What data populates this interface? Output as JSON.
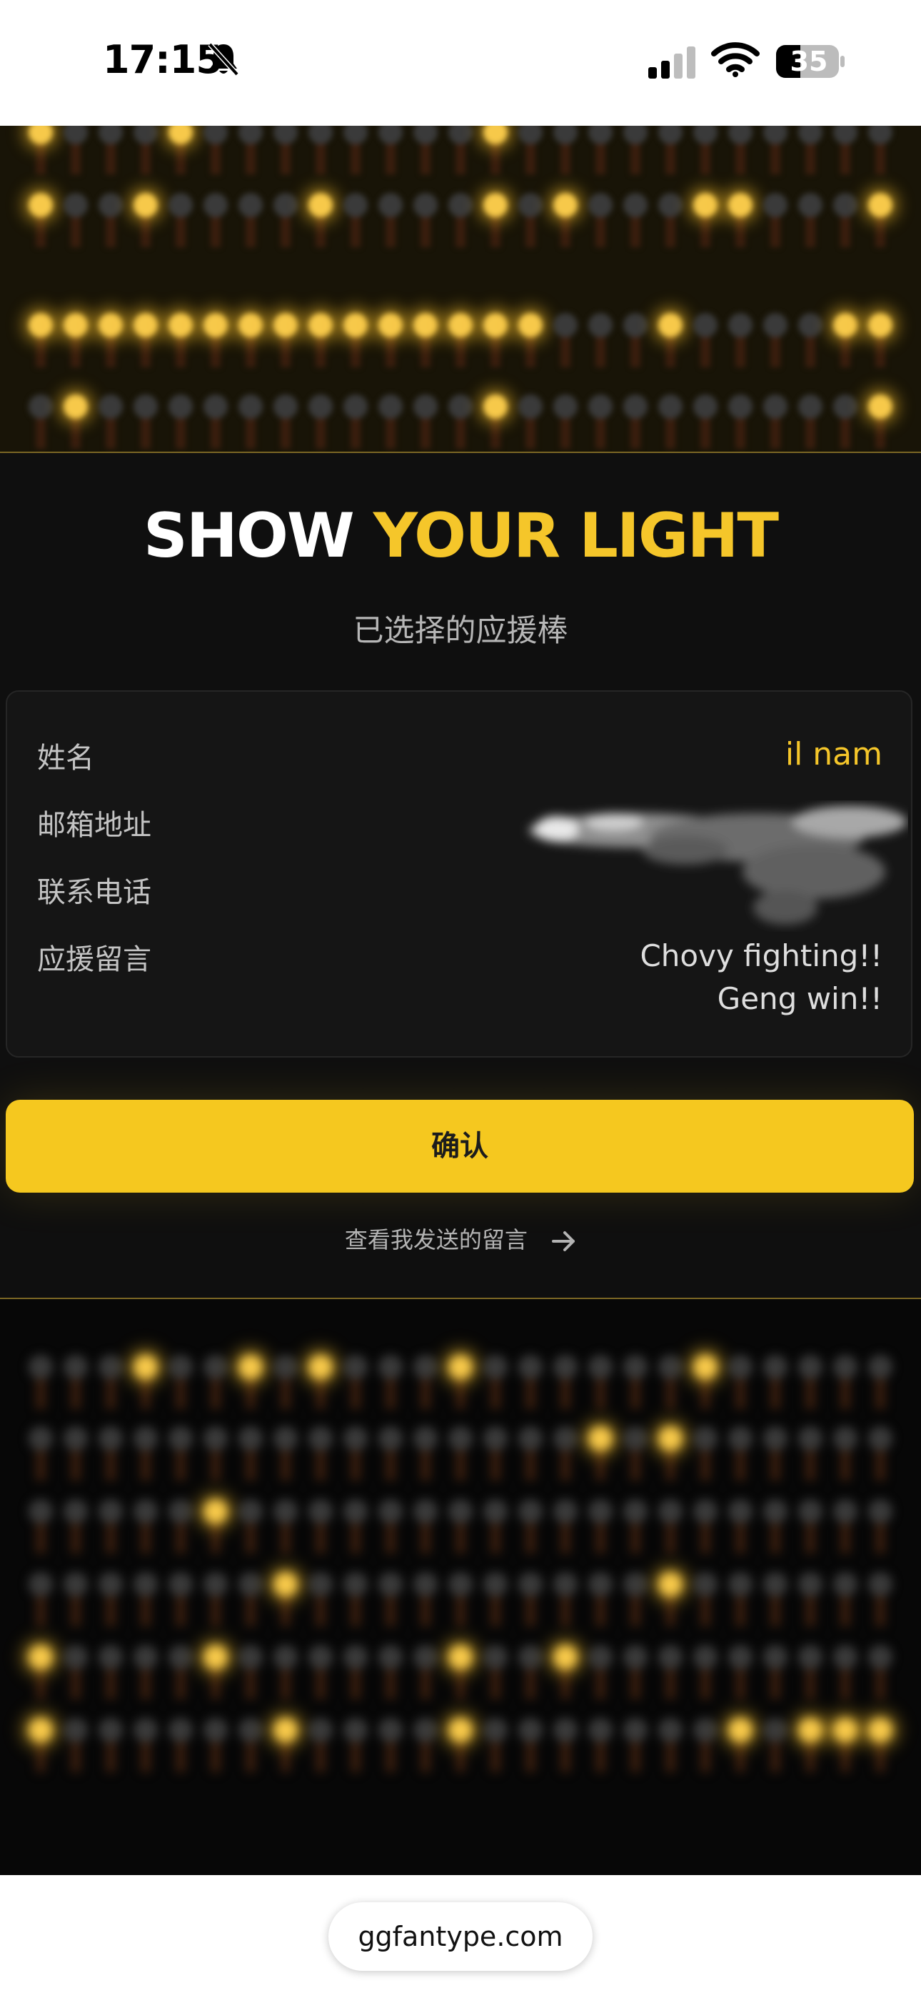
{
  "status_bar": {
    "time": "17:15",
    "battery": "35",
    "bell_icon": "bell-slash-icon",
    "signal_icon": "cellular-signal-icon",
    "wifi_icon": "wifi-icon",
    "battery_icon": "battery-icon"
  },
  "headline": {
    "part1": "SHOW",
    "part2": "YOUR LIGHT"
  },
  "subtitle": "已选择的应援棒",
  "form": {
    "name_label": "姓名",
    "name_value": "il nam",
    "email_label": "邮箱地址",
    "phone_label": "联系电话",
    "message_label": "应援留言",
    "message_line1": "Chovy fighting!!",
    "message_line2": "Geng win!!"
  },
  "confirm_label": "确认",
  "view_messages_label": "查看我发送的留言",
  "url": "ggfantype.com",
  "colors": {
    "accent": "#f5c62a",
    "button": "#f5c81f",
    "background": "#0f0f0f"
  }
}
